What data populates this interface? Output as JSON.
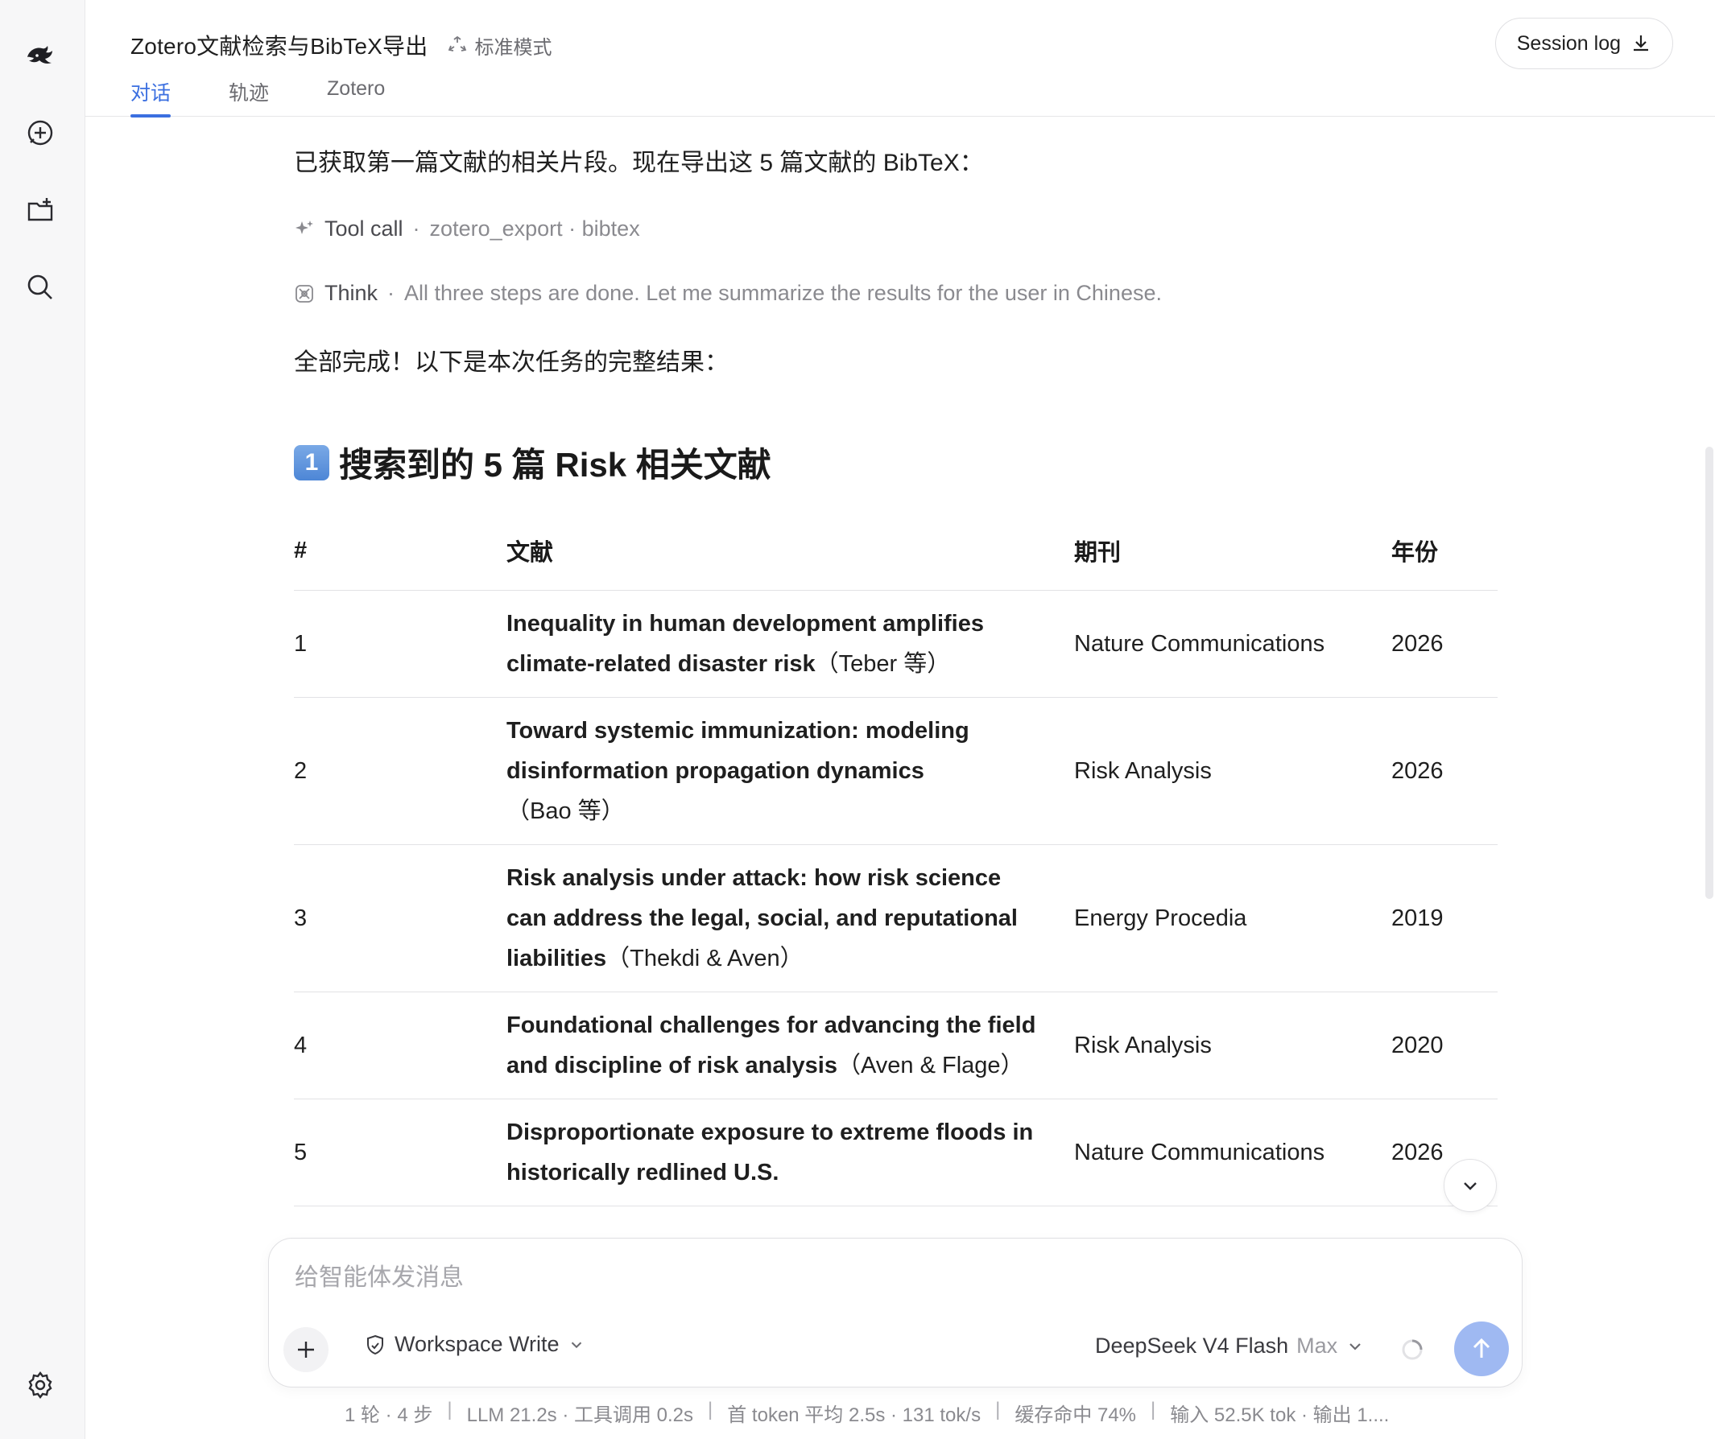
{
  "header": {
    "title": "Zotero文献检索与BibTeX导出",
    "mode": "标准模式",
    "session_log": "Session log",
    "tabs": [
      "对话",
      "轨迹",
      "Zotero"
    ]
  },
  "rail": {
    "icons": [
      "deepseek-logo-icon",
      "new-chat-icon",
      "new-folder-icon",
      "search-icon",
      "settings-icon"
    ]
  },
  "messages": {
    "intro": "已获取第一篇文献的相关片段。现在导出这 5 篇文献的 BibTeX：",
    "tool_call": {
      "label": "Tool call",
      "dot": "·",
      "detail": "zotero_export · bibtex"
    },
    "think": {
      "label": "Think",
      "dot": "·",
      "detail": "All three steps are done. Let me summarize the results for the user in Chinese."
    },
    "done": "全部完成！以下是本次任务的完整结果：",
    "section_num": "1",
    "section_title": "搜索到的 5 篇 Risk 相关文献"
  },
  "table": {
    "headers": [
      "#",
      "文献",
      "期刊",
      "年份"
    ],
    "rows": [
      {
        "num": "1",
        "title": "Inequality in human development amplifies climate-related disaster risk",
        "authors": "（Teber 等）",
        "journal": "Nature Communications",
        "year": "2026"
      },
      {
        "num": "2",
        "title": "Toward systemic immunization: modeling disinformation propagation dynamics",
        "authors": "（Bao 等）",
        "journal": "Risk Analysis",
        "year": "2026"
      },
      {
        "num": "3",
        "title": "Risk analysis under attack: how risk science can address the legal, social, and reputational liabilities",
        "authors": "（Thekdi & Aven）",
        "journal": "Energy Procedia",
        "year": "2019"
      },
      {
        "num": "4",
        "title": "Foundational challenges for advancing the field and discipline of risk analysis",
        "authors": "（Aven & Flage）",
        "journal": "Risk Analysis",
        "year": "2020"
      },
      {
        "num": "5",
        "title": "Disproportionate exposure to extreme floods in historically redlined U.S.",
        "authors": "",
        "journal": "Nature Communications",
        "year": "2026"
      }
    ]
  },
  "composer": {
    "placeholder": "给智能体发消息",
    "workspace": "Workspace Write",
    "model": "DeepSeek V4 Flash",
    "tier": "Max"
  },
  "status": {
    "items": [
      "1 轮 · 4 步",
      "LLM 21.2s · 工具调用 0.2s",
      "首 token 平均 2.5s · 131 tok/s",
      "缓存命中 74%",
      "输入 52.5K tok · 输出 1...."
    ],
    "separator": "|"
  },
  "colors": {
    "accent": "#3b6fe0",
    "send_button": "#9fb9f2",
    "muted_text": "#8a8a8f"
  }
}
